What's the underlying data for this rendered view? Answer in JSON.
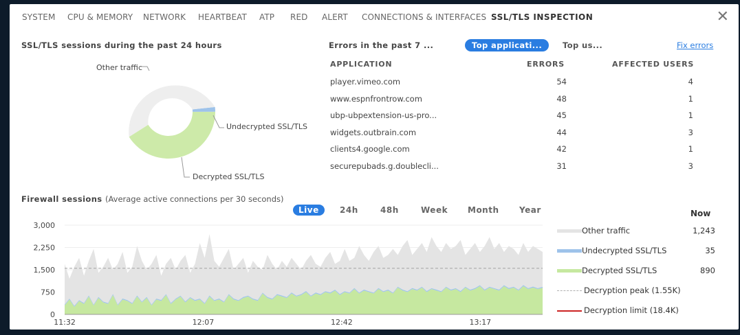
{
  "tabs": [
    "SYSTEM",
    "CPU & MEMORY",
    "NETWORK",
    "HEARTBEAT",
    "ATP",
    "RED",
    "ALERT",
    "CONNECTIONS & INTERFACES",
    "SSL/TLS INSPECTION"
  ],
  "active_tab": "SSL/TLS INSPECTION",
  "close_glyph": "✕",
  "donut": {
    "title": "SSL/TLS sessions during the past 24 hours",
    "labels": {
      "other": "Other traffic",
      "undecrypted": "Undecrypted SSL/TLS",
      "decrypted": "Decrypted SSL/TLS"
    },
    "values": {
      "other": 1243,
      "undecrypted": 35,
      "decrypted": 890
    },
    "colors": {
      "other": "#eeeeee",
      "undecrypted": "#9ec3ea",
      "decrypted": "#cdeaa9"
    }
  },
  "errors": {
    "heading": "Errors in the past 7 ...",
    "pill": "Top applicati...",
    "tab2": "Top us...",
    "fix_link": "Fix errors",
    "columns": [
      "APPLICATION",
      "ERRORS",
      "AFFECTED USERS"
    ],
    "rows": [
      {
        "app": "player.vimeo.com",
        "errors": "54",
        "users": "4"
      },
      {
        "app": "www.espnfrontrow.com",
        "errors": "48",
        "users": "1"
      },
      {
        "app": "ubp-ubpextension-us-pro...",
        "errors": "45",
        "users": "1"
      },
      {
        "app": "widgets.outbrain.com",
        "errors": "44",
        "users": "3"
      },
      {
        "app": "clients4.google.com",
        "errors": "42",
        "users": "1"
      },
      {
        "app": "securepubads.g.doublecli...",
        "errors": "31",
        "users": "3"
      }
    ]
  },
  "firewall": {
    "title": "Firewall sessions",
    "subtitle": "(Average active connections per 30 seconds)",
    "ranges": [
      "Live",
      "24h",
      "48h",
      "Week",
      "Month",
      "Year"
    ],
    "active_range": "Live",
    "now_label": "Now",
    "legend": [
      {
        "label": "Other traffic",
        "value": "1,243",
        "color": "#e4e4e4",
        "style": "band"
      },
      {
        "label": "Undecrypted SSL/TLS",
        "value": "35",
        "color": "#9ec3ea",
        "style": "band"
      },
      {
        "label": "Decrypted SSL/TLS",
        "value": "890",
        "color": "#c6e8a0",
        "style": "band"
      },
      {
        "label": "Decryption peak (1.55K)",
        "value": "",
        "color": "#b0b0b0",
        "style": "dashed"
      },
      {
        "label": "Decryption limit (18.4K)",
        "value": "",
        "color": "#cc2222",
        "style": "solid"
      }
    ]
  },
  "chart_data": {
    "type": "area",
    "x_ticks": [
      "11:32",
      "12:07",
      "12:42",
      "13:17"
    ],
    "y_ticks": [
      "3,000",
      "2,250",
      "1,500",
      "750",
      "0"
    ],
    "ylim": [
      0,
      3000
    ],
    "decryption_peak": 1550,
    "series": [
      {
        "name": "Other traffic",
        "values": [
          1700,
          1200,
          1600,
          1900,
          1300,
          1800,
          2200,
          1400,
          1600,
          1900,
          1500,
          1700,
          2100,
          1400,
          1600,
          2300,
          1800,
          1500,
          1700,
          2000,
          1300,
          1700,
          1900,
          1500,
          1800,
          2000,
          1400,
          1700,
          2400,
          1900,
          2700,
          1800,
          1600,
          1900,
          2200,
          1500,
          1700,
          1900,
          1400,
          1800,
          1600,
          1500,
          2000,
          1700,
          1500,
          1800,
          1600,
          1900,
          1700,
          1500,
          1800,
          2000,
          1700,
          1600,
          1900,
          2100,
          1700,
          1800,
          2200,
          1800,
          1900,
          2300,
          2000,
          1800,
          2100,
          2300,
          1900,
          2000,
          2200,
          2000,
          2300,
          2500,
          2000,
          2200,
          2400,
          2100,
          2600,
          2300,
          2100,
          2400,
          2200,
          2300,
          2500,
          2000,
          2200,
          2400,
          2100,
          2300,
          2600,
          2200,
          2400,
          2100,
          2300,
          2200,
          2000,
          2400,
          2100,
          2300,
          2200,
          2100
        ]
      },
      {
        "name": "Undecrypted SSL/TLS",
        "values": [
          30,
          30,
          35,
          30,
          30,
          35,
          30,
          35,
          30,
          30,
          35,
          30,
          35,
          30,
          30,
          35,
          30,
          35,
          30,
          30,
          35,
          30,
          35,
          30,
          30,
          35,
          30,
          35,
          30,
          30,
          35,
          30,
          35,
          30,
          30,
          35,
          30,
          35,
          30,
          30,
          35,
          30,
          35,
          30,
          30,
          35,
          30,
          35,
          30,
          30,
          35,
          30,
          35,
          30,
          30,
          35,
          30,
          35,
          30,
          30,
          35,
          30,
          35,
          30,
          30,
          35,
          30,
          35,
          30,
          30,
          35,
          30,
          35,
          30,
          30,
          35,
          30,
          35,
          30,
          30,
          35,
          30,
          35,
          30,
          30,
          35,
          30,
          35,
          30,
          30,
          35,
          30,
          35,
          30,
          30,
          35,
          30,
          35,
          30,
          35
        ]
      },
      {
        "name": "Decrypted SSL/TLS",
        "values": [
          300,
          500,
          250,
          450,
          350,
          600,
          300,
          550,
          400,
          350,
          650,
          300,
          500,
          450,
          350,
          600,
          400,
          550,
          300,
          500,
          450,
          650,
          350,
          500,
          600,
          400,
          550,
          450,
          500,
          350,
          600,
          450,
          500,
          400,
          650,
          500,
          450,
          550,
          600,
          500,
          450,
          700,
          550,
          500,
          650,
          600,
          550,
          700,
          600,
          650,
          750,
          600,
          700,
          650,
          750,
          700,
          800,
          650,
          750,
          700,
          850,
          700,
          800,
          750,
          700,
          850,
          750,
          800,
          700,
          900,
          800,
          750,
          850,
          800,
          900,
          750,
          850,
          800,
          750,
          900,
          800,
          850,
          750,
          900,
          800,
          850,
          950,
          800,
          900,
          850,
          800,
          950,
          850,
          900,
          800,
          950,
          850,
          900,
          850,
          890
        ]
      }
    ]
  }
}
